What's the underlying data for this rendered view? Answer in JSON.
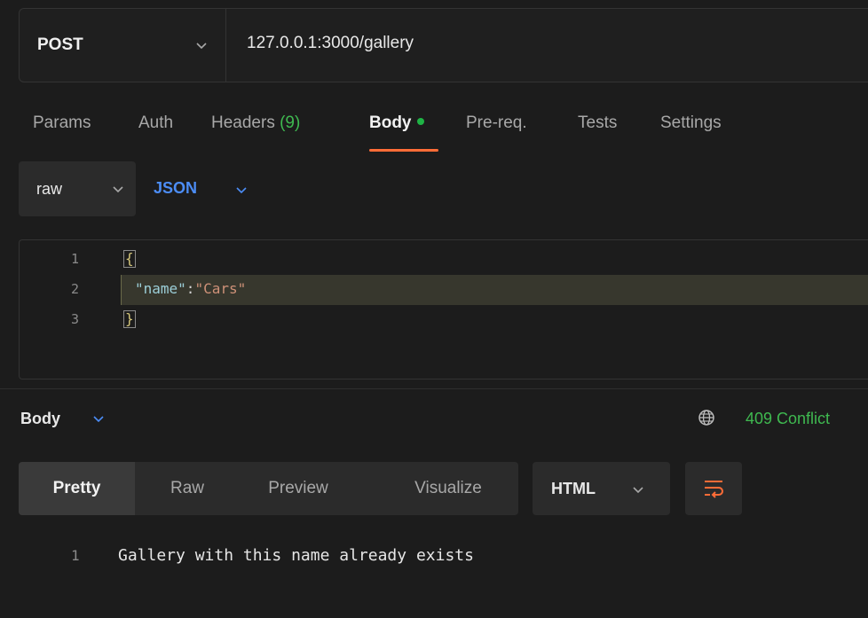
{
  "request": {
    "method": "POST",
    "url": "127.0.0.1:3000/gallery"
  },
  "tabs": {
    "params": "Params",
    "auth": "Auth",
    "headers": "Headers",
    "headers_count": "(9)",
    "body": "Body",
    "prereq": "Pre-req.",
    "tests": "Tests",
    "settings": "Settings",
    "active": "Body"
  },
  "body_mode": {
    "mode": "raw",
    "language": "JSON"
  },
  "editor": {
    "lines": [
      {
        "num": "1",
        "text": "{"
      },
      {
        "num": "2",
        "key": "\"name\"",
        "sep": ":",
        "value": "\"Cars\""
      },
      {
        "num": "3",
        "text": "}"
      }
    ]
  },
  "response": {
    "label": "Body",
    "status": "409 Conflict",
    "status_color": "#3fb950",
    "views": [
      "Pretty",
      "Raw",
      "Preview",
      "Visualize"
    ],
    "active_view": "Pretty",
    "format": "HTML",
    "wrap_icon": "wrap-lines-icon",
    "lines": [
      {
        "num": "1",
        "text": "Gallery with this name already exists"
      }
    ]
  },
  "colors": {
    "accent": "#ff6c37",
    "json_blue": "#4c8df6",
    "status_green": "#3fb950"
  }
}
